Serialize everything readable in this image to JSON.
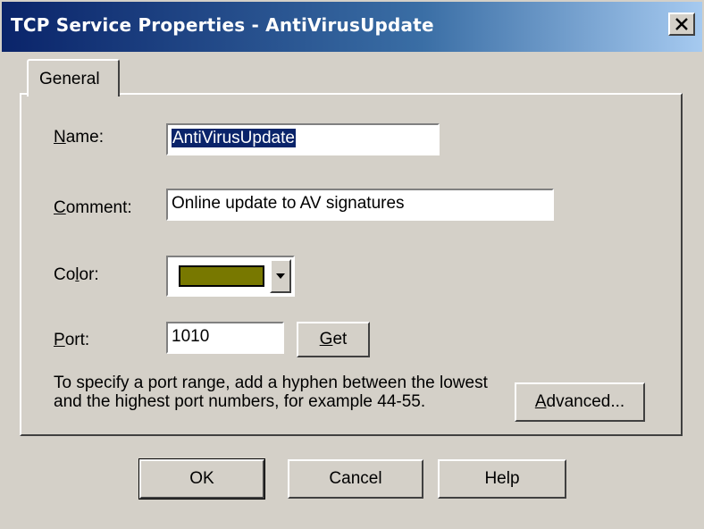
{
  "window": {
    "title": "TCP Service Properties - AntiVirusUpdate",
    "close_symbol": "×"
  },
  "tabs": [
    {
      "label": "General",
      "active": true
    }
  ],
  "form": {
    "name": {
      "label_underline": "N",
      "label_rest": "ame:",
      "value": "AntiVirusUpdate"
    },
    "comment": {
      "label_underline": "C",
      "label_rest": "omment:",
      "value": "Online update to AV signatures"
    },
    "color": {
      "label_pre": "Co",
      "label_underline": "l",
      "label_rest": "or:",
      "value": "#787800"
    },
    "port": {
      "label_underline": "P",
      "label_rest": "ort:",
      "value": "1010"
    },
    "get_button": {
      "label_underline": "G",
      "label_rest": "et"
    },
    "help_text": "To specify a port range, add a hyphen between the lowest and the highest port numbers, for example 44-55.",
    "advanced_button": {
      "label_underline": "A",
      "label_rest": "dvanced..."
    }
  },
  "buttons": {
    "ok": "OK",
    "cancel": "Cancel",
    "help": "Help"
  },
  "colors": {
    "titlebar_start": "#0a246a",
    "titlebar_end": "#a6caf0",
    "face": "#d4d0c8",
    "selection": "#0a246a"
  },
  "icons": {
    "close": "close-icon",
    "dropdown": "chevron-down-icon"
  }
}
